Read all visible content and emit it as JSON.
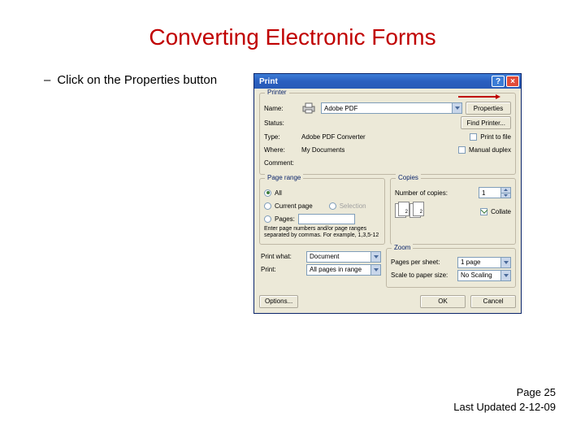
{
  "slide": {
    "title": "Converting Electronic Forms",
    "bullet_dash": "–",
    "bullet_text": "Click on the Properties button"
  },
  "dialog": {
    "title": "Print",
    "help": "?",
    "close": "×",
    "printer": {
      "group_label": "Printer",
      "name_label": "Name:",
      "name_value": "Adobe PDF",
      "status_label": "Status:",
      "type_label": "Type:",
      "type_value": "Adobe PDF Converter",
      "where_label": "Where:",
      "where_value": "My Documents",
      "comment_label": "Comment:",
      "properties_btn": "Properties",
      "find_printer_btn": "Find Printer...",
      "print_to_file": "Print to file",
      "manual_duplex": "Manual duplex"
    },
    "range": {
      "group_label": "Page range",
      "all": "All",
      "current": "Current page",
      "selection": "Selection",
      "pages": "Pages:",
      "hint": "Enter page numbers and/or page ranges separated by commas. For example, 1,3,5-12"
    },
    "copies": {
      "group_label": "Copies",
      "num_label": "Number of copies:",
      "num_value": "1",
      "collate": "Collate",
      "p1": "1",
      "p2": "2"
    },
    "what": {
      "print_what_label": "Print what:",
      "print_what_value": "Document",
      "print_label": "Print:",
      "print_value": "All pages in range"
    },
    "zoom": {
      "group_label": "Zoom",
      "pps_label": "Pages per sheet:",
      "pps_value": "1 page",
      "scale_label": "Scale to paper size:",
      "scale_value": "No Scaling"
    },
    "options_btn": "Options...",
    "ok_btn": "OK",
    "cancel_btn": "Cancel"
  },
  "footer": {
    "page": "Page 25",
    "updated": "Last Updated 2-12-09"
  }
}
